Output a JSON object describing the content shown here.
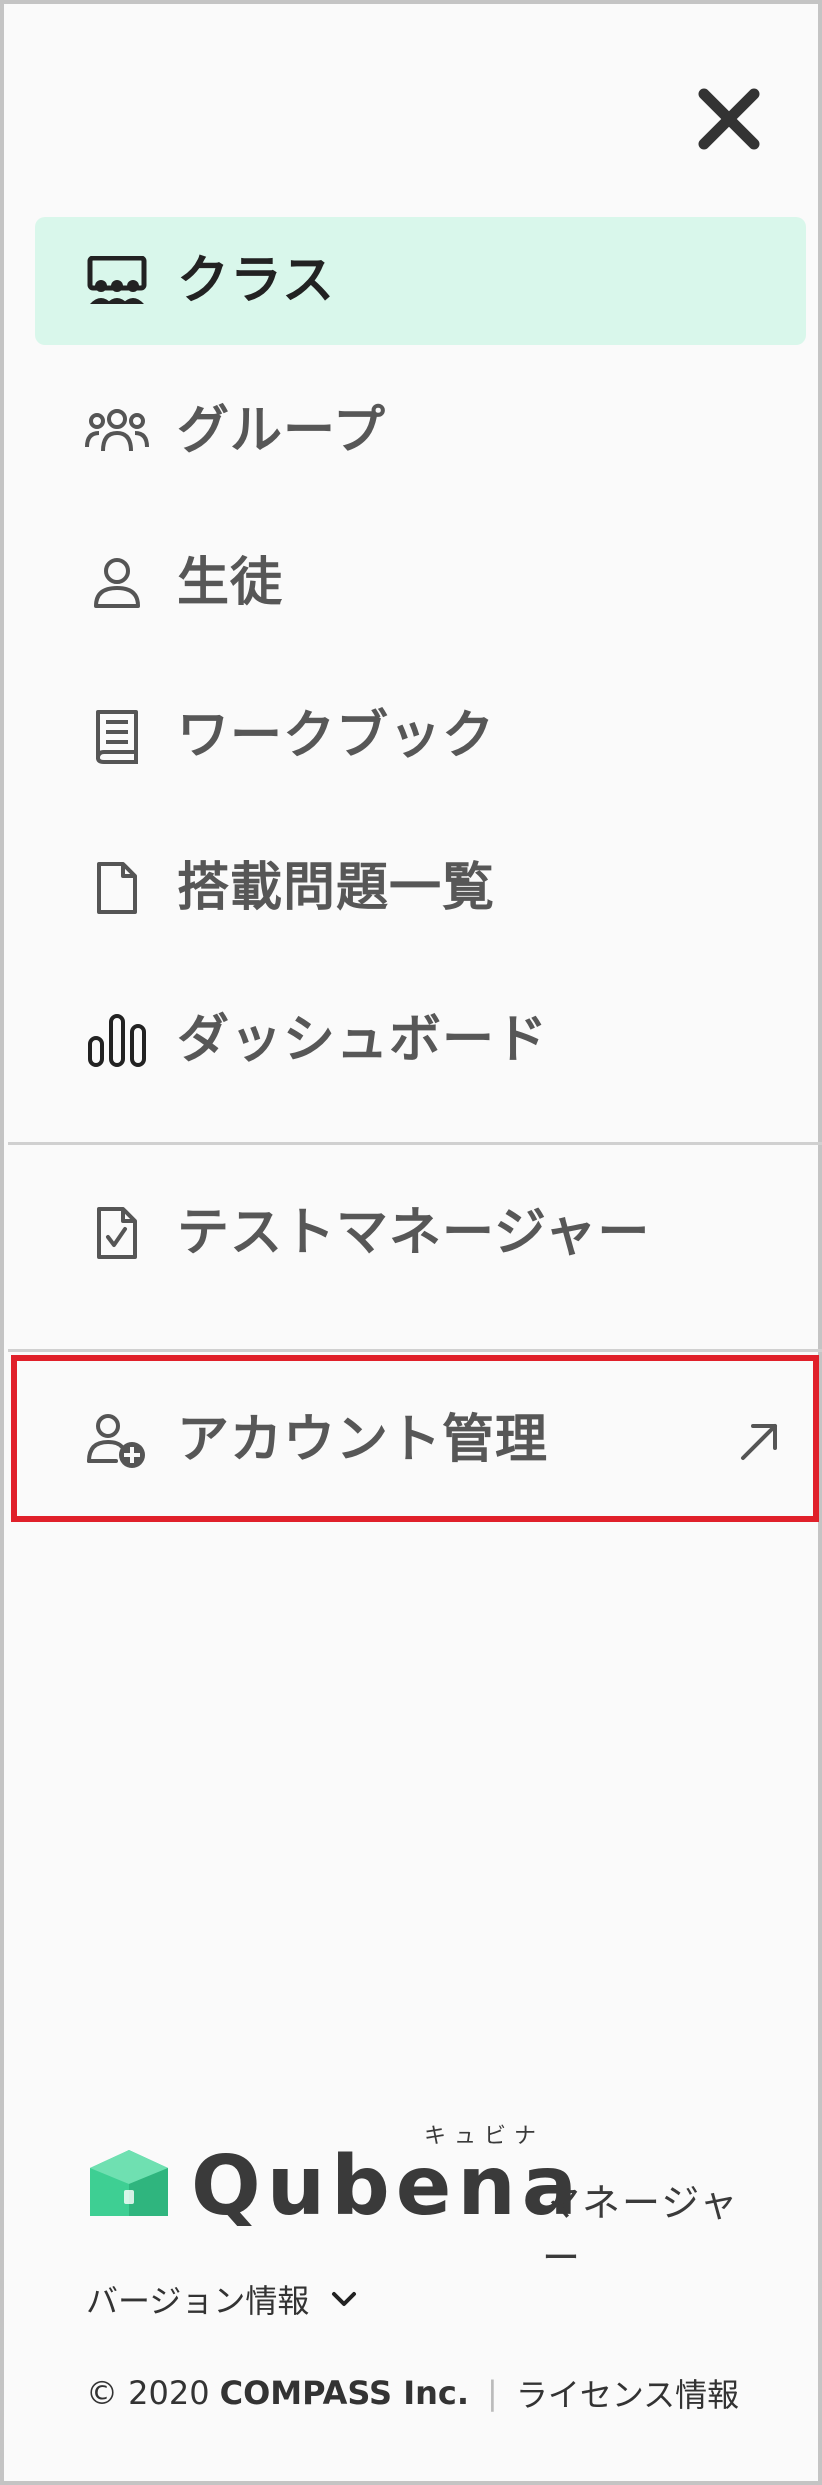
{
  "nav": {
    "items": [
      {
        "id": "class",
        "label": "クラス",
        "icon": "classroom-icon",
        "active": true
      },
      {
        "id": "group",
        "label": "グループ",
        "icon": "group-icon",
        "active": false
      },
      {
        "id": "student",
        "label": "生徒",
        "icon": "person-icon",
        "active": false
      },
      {
        "id": "workbook",
        "label": "ワークブック",
        "icon": "book-icon",
        "active": false
      },
      {
        "id": "problems",
        "label": "搭載問題一覧",
        "icon": "document-icon",
        "active": false
      },
      {
        "id": "dashboard",
        "label": "ダッシュボード",
        "icon": "bar-chart-icon",
        "active": false
      }
    ],
    "test_manager": {
      "label": "テストマネージャー",
      "icon": "document-check-icon"
    },
    "account": {
      "label": "アカウント管理",
      "icon": "add-person-icon",
      "external_icon": "external-link-arrow-icon"
    }
  },
  "logo": {
    "brand": "Qubena",
    "ruby": "キュビナ",
    "suffix": "マネージャー"
  },
  "version_label": "バージョン情報",
  "footer": {
    "copyright": "© 2020",
    "company": "COMPASS Inc.",
    "separator": "|",
    "license_label": "ライセンス情報"
  },
  "colors": {
    "active_bg": "#d9f7eb",
    "highlight_border": "#e0202a",
    "brand_green": "#3ecf93"
  }
}
